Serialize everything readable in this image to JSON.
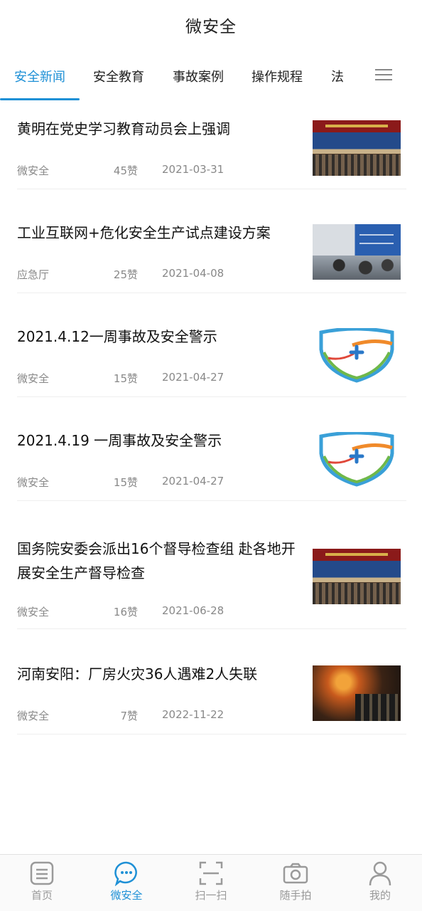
{
  "header": {
    "title": "微安全"
  },
  "tabs": [
    {
      "label": "安全新闻"
    },
    {
      "label": "安全教育"
    },
    {
      "label": "事故案例"
    },
    {
      "label": "操作规程"
    },
    {
      "label": "法"
    }
  ],
  "articles": [
    {
      "title": "黄明在党史学习教育动员会上强调",
      "source": "微安全",
      "likes": "45赞",
      "date": "2021-03-31",
      "thumb": "meeting-photo"
    },
    {
      "title": "工业互联网+危化安全生产试点建设方案",
      "source": "应急厅",
      "likes": "25赞",
      "date": "2021-04-08",
      "thumb": "meeting-photo"
    },
    {
      "title": "2021.4.12一周事故及安全警示",
      "source": "微安全",
      "likes": "15赞",
      "date": "2021-04-27",
      "thumb": "shield-logo"
    },
    {
      "title": "2021.4.19 一周事故及安全警示",
      "source": "微安全",
      "likes": "15赞",
      "date": "2021-04-27",
      "thumb": "shield-logo"
    },
    {
      "title": "国务院安委会派出16个督导检查组 赴各地开展安全生产督导检查",
      "source": "微安全",
      "likes": "16赞",
      "date": "2021-06-28",
      "thumb": "meeting-photo"
    },
    {
      "title": "河南安阳：厂房火灾36人遇难2人失联",
      "source": "微安全",
      "likes": "7赞",
      "date": "2022-11-22",
      "thumb": "fire-photo"
    }
  ],
  "nav": [
    {
      "label": "首页",
      "icon": "home-icon"
    },
    {
      "label": "微安全",
      "icon": "chat-icon"
    },
    {
      "label": "扫一扫",
      "icon": "scan-icon"
    },
    {
      "label": "随手拍",
      "icon": "camera-icon"
    },
    {
      "label": "我的",
      "icon": "profile-icon"
    }
  ],
  "colors": {
    "accent": "#1e90d6",
    "text": "#111111",
    "muted": "#888888"
  }
}
